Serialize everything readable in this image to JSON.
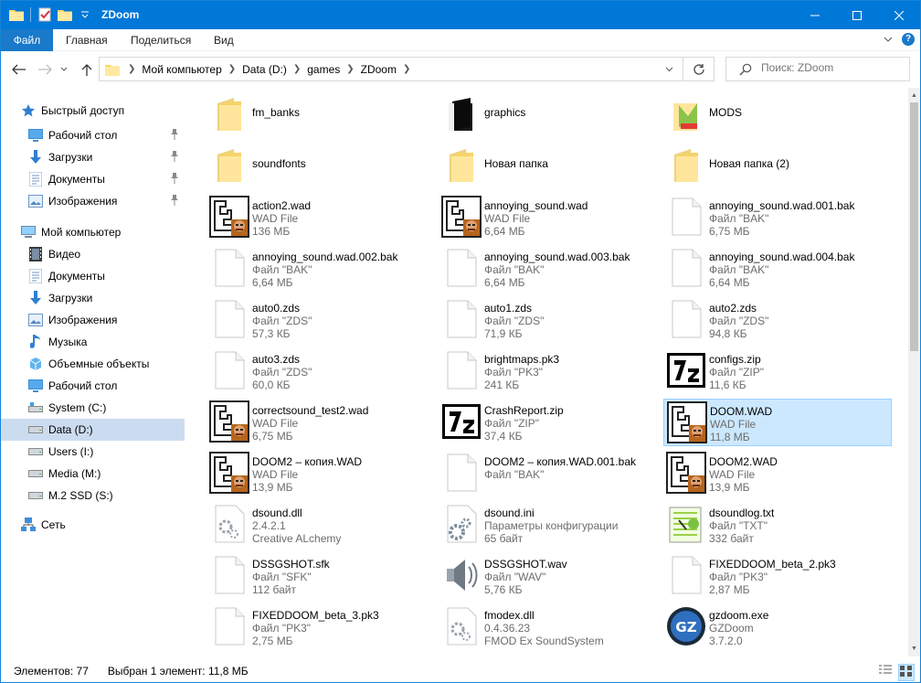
{
  "window": {
    "title": "ZDoom",
    "controls": {
      "minimize": "minimize-icon",
      "maximize": "maximize-icon",
      "close": "close-icon"
    }
  },
  "ribbon": {
    "tabs": [
      "Файл",
      "Главная",
      "Поделиться",
      "Вид"
    ],
    "help": "?"
  },
  "address": {
    "crumbs": [
      "Мой компьютер",
      "Data (D:)",
      "games",
      "ZDoom"
    ]
  },
  "search": {
    "placeholder": "Поиск: ZDoom"
  },
  "sidebar": {
    "items": [
      {
        "label": "Быстрый доступ",
        "icon": "star-icon",
        "pinned": false
      },
      {
        "label": "Рабочий стол",
        "icon": "desktop-icon",
        "pinned": true
      },
      {
        "label": "Загрузки",
        "icon": "downloads-icon",
        "pinned": true
      },
      {
        "label": "Документы",
        "icon": "documents-icon",
        "pinned": true
      },
      {
        "label": "Изображения",
        "icon": "pictures-icon",
        "pinned": true
      },
      {
        "label": "Мой компьютер",
        "icon": "computer-icon",
        "pinned": false
      },
      {
        "label": "Видео",
        "icon": "video-icon",
        "pinned": false
      },
      {
        "label": "Документы",
        "icon": "documents-icon",
        "pinned": false
      },
      {
        "label": "Загрузки",
        "icon": "downloads-icon",
        "pinned": false
      },
      {
        "label": "Изображения",
        "icon": "pictures-icon",
        "pinned": false
      },
      {
        "label": "Музыка",
        "icon": "music-icon",
        "pinned": false
      },
      {
        "label": "Объемные объекты",
        "icon": "3d-objects-icon",
        "pinned": false
      },
      {
        "label": "Рабочий стол",
        "icon": "desktop-icon",
        "pinned": false
      },
      {
        "label": "System (C:)",
        "icon": "system-drive-icon",
        "pinned": false
      },
      {
        "label": "Data (D:)",
        "icon": "drive-icon",
        "pinned": false,
        "selected": true
      },
      {
        "label": "Users (I:)",
        "icon": "drive-icon",
        "pinned": false
      },
      {
        "label": "Media (M:)",
        "icon": "drive-icon",
        "pinned": false
      },
      {
        "label": "M.2 SSD (S:)",
        "icon": "drive-icon",
        "pinned": false
      },
      {
        "label": "Сеть",
        "icon": "network-icon",
        "pinned": false
      }
    ]
  },
  "files": [
    {
      "name": "fm_banks",
      "icon": "folder"
    },
    {
      "name": "graphics",
      "icon": "folder-dark"
    },
    {
      "name": "MODS",
      "icon": "folder-mods"
    },
    {
      "name": "soundfonts",
      "icon": "folder"
    },
    {
      "name": "Новая папка",
      "icon": "folder"
    },
    {
      "name": "Новая папка (2)",
      "icon": "folder"
    },
    {
      "name": "action2.wad",
      "type": "WAD File",
      "size": "136 МБ",
      "icon": "wad"
    },
    {
      "name": "annoying_sound.wad",
      "type": "WAD File",
      "size": "6,64 МБ",
      "icon": "wad"
    },
    {
      "name": "annoying_sound.wad.001.bak",
      "type": "Файл \"BAK\"",
      "size": "6,75 МБ",
      "icon": "blank"
    },
    {
      "name": "annoying_sound.wad.002.bak",
      "type": "Файл \"BAK\"",
      "size": "6,64 МБ",
      "icon": "blank"
    },
    {
      "name": "annoying_sound.wad.003.bak",
      "type": "Файл \"BAK\"",
      "size": "6,64 МБ",
      "icon": "blank"
    },
    {
      "name": "annoying_sound.wad.004.bak",
      "type": "Файл \"BAK\"",
      "size": "6,64 МБ",
      "icon": "blank"
    },
    {
      "name": "auto0.zds",
      "type": "Файл \"ZDS\"",
      "size": "57,3 КБ",
      "icon": "blank"
    },
    {
      "name": "auto1.zds",
      "type": "Файл \"ZDS\"",
      "size": "71,9 КБ",
      "icon": "blank"
    },
    {
      "name": "auto2.zds",
      "type": "Файл \"ZDS\"",
      "size": "94,8 КБ",
      "icon": "blank"
    },
    {
      "name": "auto3.zds",
      "type": "Файл \"ZDS\"",
      "size": "60,0 КБ",
      "icon": "blank"
    },
    {
      "name": "brightmaps.pk3",
      "type": "Файл \"PK3\"",
      "size": "241 КБ",
      "icon": "blank"
    },
    {
      "name": "configs.zip",
      "type": "Файл \"ZIP\"",
      "size": "11,6 КБ",
      "icon": "7z"
    },
    {
      "name": "correctsound_test2.wad",
      "type": "WAD File",
      "size": "6,75 МБ",
      "icon": "wad"
    },
    {
      "name": "CrashReport.zip",
      "type": "Файл \"ZIP\"",
      "size": "37,4 КБ",
      "icon": "7z"
    },
    {
      "name": "DOOM.WAD",
      "type": "WAD File",
      "size": "11,8 МБ",
      "icon": "wad",
      "selected": true
    },
    {
      "name": "DOOM2 – копия.WAD",
      "type": "WAD File",
      "size": "13,9 МБ",
      "icon": "wad"
    },
    {
      "name": "DOOM2 – копия.WAD.001.bak",
      "type": "Файл \"BAK\"",
      "size": "",
      "icon": "blank"
    },
    {
      "name": "DOOM2.WAD",
      "type": "WAD File",
      "size": "13,9 МБ",
      "icon": "wad"
    },
    {
      "name": "dsound.dll",
      "type": "2.4.2.1",
      "size": "Creative ALchemy",
      "icon": "dll"
    },
    {
      "name": "dsound.ini",
      "type": "Параметры конфигурации",
      "size": "65 байт",
      "icon": "ini"
    },
    {
      "name": "dsoundlog.txt",
      "type": "Файл \"TXT\"",
      "size": "332 байт",
      "icon": "txt"
    },
    {
      "name": "DSSGSHOT.sfk",
      "type": "Файл \"SFK\"",
      "size": "112 байт",
      "icon": "blank"
    },
    {
      "name": "DSSGSHOT.wav",
      "type": "Файл \"WAV\"",
      "size": "5,76 КБ",
      "icon": "wav"
    },
    {
      "name": "FIXEDDOOM_beta_2.pk3",
      "type": "Файл \"PK3\"",
      "size": "2,87 МБ",
      "icon": "blank"
    },
    {
      "name": "FIXEDDOOM_beta_3.pk3",
      "type": "Файл \"PK3\"",
      "size": "2,75 МБ",
      "icon": "blank"
    },
    {
      "name": "fmodex.dll",
      "type": "0.4.36.23",
      "size": "FMOD Ex SoundSystem",
      "icon": "dll"
    },
    {
      "name": "gzdoom.exe",
      "type": "GZDoom",
      "size": "3.7.2.0",
      "icon": "gzdoom"
    }
  ],
  "status": {
    "count": "Элементов: 77",
    "selection": "Выбран 1 элемент: 11,8 МБ"
  },
  "colors": {
    "titlebar": "#0078d7",
    "selection": "#cce8ff",
    "nav_selected": "#ccdcf0"
  }
}
